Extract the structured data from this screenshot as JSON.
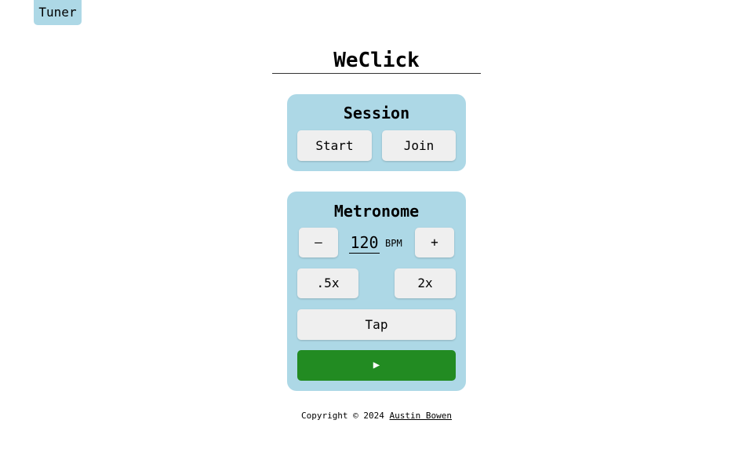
{
  "tuner_label": "Tuner",
  "app_title": "WeClick",
  "session": {
    "heading": "Session",
    "start_label": "Start",
    "join_label": "Join"
  },
  "metronome": {
    "heading": "Metronome",
    "decrement_label": "–",
    "increment_label": "+",
    "bpm_value": "120",
    "bpm_unit": "BPM",
    "half_speed_label": ".5x",
    "double_speed_label": "2x",
    "tap_label": "Tap",
    "play_icon": "▶"
  },
  "footer": {
    "copyright_text": "Copyright © 2024",
    "author_link": "Austin Bowen"
  },
  "colors": {
    "card_bg": "#add8e6",
    "button_bg": "#efefef",
    "play_bg": "#228b22"
  }
}
